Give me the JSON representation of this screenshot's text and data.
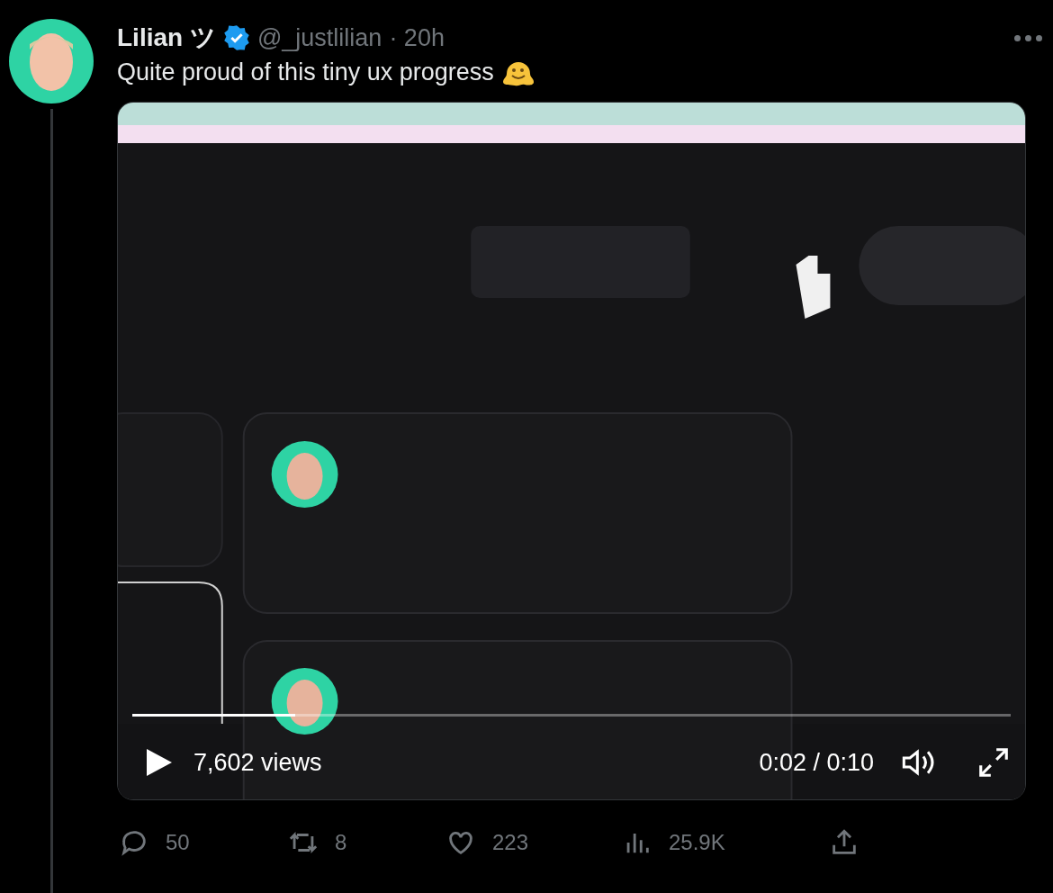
{
  "post": {
    "author": {
      "name": "Lilian ツ",
      "verified": true,
      "handle": "@_justlilian",
      "time": "· 20h"
    },
    "text": "Quite proud of this tiny ux progress",
    "video": {
      "playing": false,
      "level": 0.185,
      "views": "7,602 views",
      "time": "0:02 / 0:10"
    },
    "actions": [
      {
        "kind": "reply",
        "count": "50"
      },
      {
        "kind": "repost",
        "count": "8"
      },
      {
        "kind": "like",
        "count": "223"
      },
      {
        "kind": "views",
        "count": "25.9K"
      },
      {
        "kind": "share"
      }
    ]
  }
}
